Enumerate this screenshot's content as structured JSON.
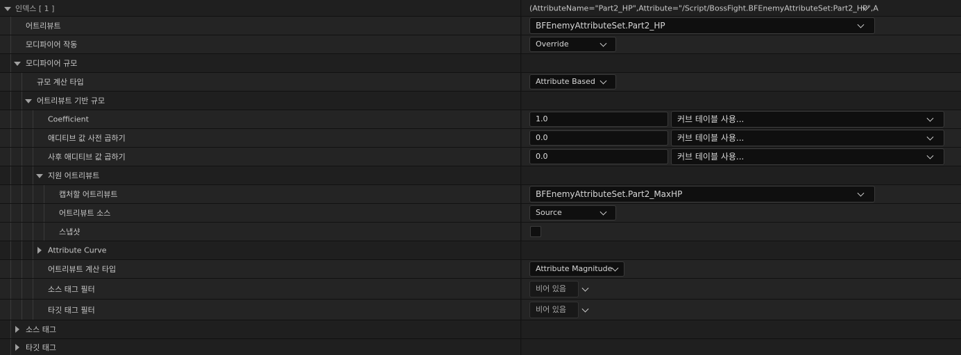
{
  "index_row": {
    "label": "인덱스 [ 1 ]",
    "value": "(AttributeName=\"Part2_HP\",Attribute=\"/Script/BossFight.BFEnemyAttributeSet:Part2_HP\",A"
  },
  "attribute": {
    "label": "어트리뷰트",
    "value": "BFEnemyAttributeSet.Part2_HP"
  },
  "modifier_op": {
    "label": "모디파이어 작동",
    "value": "Override"
  },
  "modifier_magnitude": {
    "label": "모디파이어 규모"
  },
  "magnitude_calc_type": {
    "label": "규모 계산 타입",
    "value": "Attribute Based"
  },
  "attribute_based_magnitude": {
    "label": "어트리뷰트 기반 규모"
  },
  "coefficient": {
    "label": "Coefficient",
    "value": "1.0",
    "curve": "커브 테이블 사용..."
  },
  "pre_multiply": {
    "label": "애디티브 값 사전 곱하기",
    "value": "0.0",
    "curve": "커브 테이블 사용..."
  },
  "post_multiply": {
    "label": "사후 애디티브 값 곱하기",
    "value": "0.0",
    "curve": "커브 테이블 사용..."
  },
  "backing_attribute": {
    "label": "지원 어트리뷰트"
  },
  "capture_attribute": {
    "label": "캡처할 어트리뷰트",
    "value": "BFEnemyAttributeSet.Part2_MaxHP"
  },
  "attribute_source": {
    "label": "어트리뷰트 소스",
    "value": "Source"
  },
  "snapshot": {
    "label": "스냅샷",
    "checked": false
  },
  "attribute_curve": {
    "label": "Attribute Curve"
  },
  "attribute_calc_type": {
    "label": "어트리뷰트 계산 타입",
    "value": "Attribute Magnitude"
  },
  "source_tag_filter": {
    "label": "소스 태그 필터",
    "value": "비어 있음"
  },
  "target_tag_filter": {
    "label": "타깃 태그 필터",
    "value": "비어 있음"
  },
  "source_tags": {
    "label": "소스 태그"
  },
  "target_tags": {
    "label": "타깃 태그"
  },
  "colors": {
    "background": "#1c1c1c",
    "row": "#242424",
    "input": "#0f0f0f",
    "text": "#c8c8c8"
  }
}
